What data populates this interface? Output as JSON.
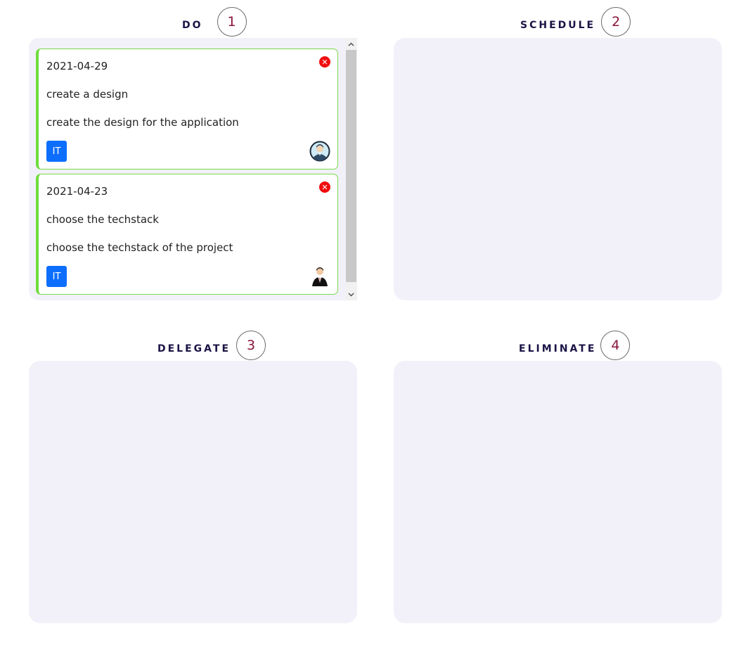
{
  "quadrants": {
    "do": {
      "title": "DO",
      "number": "1"
    },
    "schedule": {
      "title": "SCHEDULE",
      "number": "2"
    },
    "delegate": {
      "title": "DELEGATE",
      "number": "3"
    },
    "eliminate": {
      "title": "ELIMINATE",
      "number": "4"
    }
  },
  "tasks": [
    {
      "date": "2021-04-29",
      "title": "create a design",
      "description": "create the design for the application",
      "tag": "IT",
      "avatar_icon": "avatar-icon"
    },
    {
      "date": "2021-04-23",
      "title": "choose the techstack",
      "description": "choose the techstack of the project",
      "tag": "IT",
      "avatar_icon": "avatar-icon"
    }
  ],
  "icons": {
    "close": "close-icon",
    "scroll_up": "chevron-up-icon",
    "scroll_down": "chevron-down-icon"
  },
  "colors": {
    "quadrant_bg": "#f2f1fa",
    "title": "#1a1446",
    "number": "#8a1538",
    "card_accent": "#6fdc3b",
    "close": "#f00d0d",
    "tag": "#0d6efd"
  }
}
